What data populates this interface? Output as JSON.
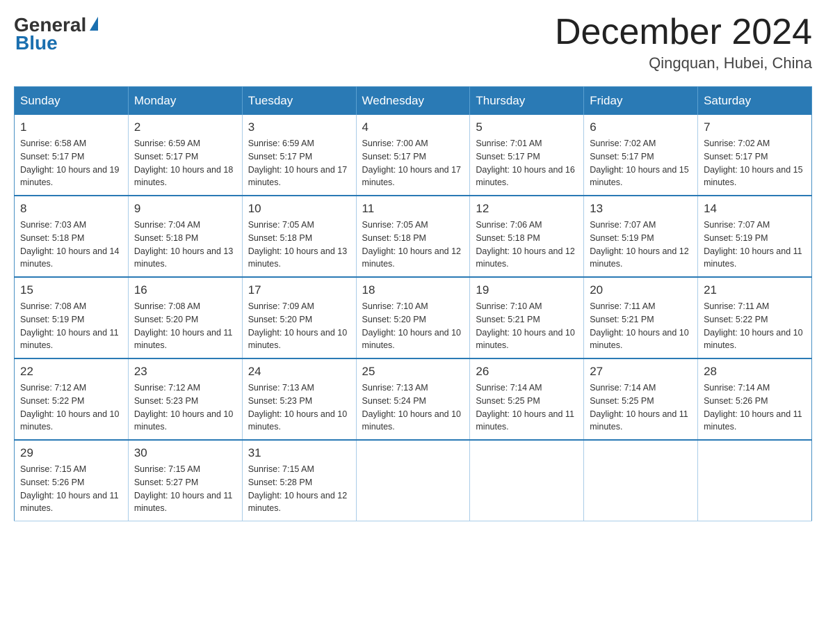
{
  "logo": {
    "general": "General",
    "blue": "Blue"
  },
  "header": {
    "month_title": "December 2024",
    "location": "Qingquan, Hubei, China"
  },
  "days_of_week": [
    "Sunday",
    "Monday",
    "Tuesday",
    "Wednesday",
    "Thursday",
    "Friday",
    "Saturday"
  ],
  "weeks": [
    [
      {
        "day": "1",
        "sunrise": "Sunrise: 6:58 AM",
        "sunset": "Sunset: 5:17 PM",
        "daylight": "Daylight: 10 hours and 19 minutes."
      },
      {
        "day": "2",
        "sunrise": "Sunrise: 6:59 AM",
        "sunset": "Sunset: 5:17 PM",
        "daylight": "Daylight: 10 hours and 18 minutes."
      },
      {
        "day": "3",
        "sunrise": "Sunrise: 6:59 AM",
        "sunset": "Sunset: 5:17 PM",
        "daylight": "Daylight: 10 hours and 17 minutes."
      },
      {
        "day": "4",
        "sunrise": "Sunrise: 7:00 AM",
        "sunset": "Sunset: 5:17 PM",
        "daylight": "Daylight: 10 hours and 17 minutes."
      },
      {
        "day": "5",
        "sunrise": "Sunrise: 7:01 AM",
        "sunset": "Sunset: 5:17 PM",
        "daylight": "Daylight: 10 hours and 16 minutes."
      },
      {
        "day": "6",
        "sunrise": "Sunrise: 7:02 AM",
        "sunset": "Sunset: 5:17 PM",
        "daylight": "Daylight: 10 hours and 15 minutes."
      },
      {
        "day": "7",
        "sunrise": "Sunrise: 7:02 AM",
        "sunset": "Sunset: 5:17 PM",
        "daylight": "Daylight: 10 hours and 15 minutes."
      }
    ],
    [
      {
        "day": "8",
        "sunrise": "Sunrise: 7:03 AM",
        "sunset": "Sunset: 5:18 PM",
        "daylight": "Daylight: 10 hours and 14 minutes."
      },
      {
        "day": "9",
        "sunrise": "Sunrise: 7:04 AM",
        "sunset": "Sunset: 5:18 PM",
        "daylight": "Daylight: 10 hours and 13 minutes."
      },
      {
        "day": "10",
        "sunrise": "Sunrise: 7:05 AM",
        "sunset": "Sunset: 5:18 PM",
        "daylight": "Daylight: 10 hours and 13 minutes."
      },
      {
        "day": "11",
        "sunrise": "Sunrise: 7:05 AM",
        "sunset": "Sunset: 5:18 PM",
        "daylight": "Daylight: 10 hours and 12 minutes."
      },
      {
        "day": "12",
        "sunrise": "Sunrise: 7:06 AM",
        "sunset": "Sunset: 5:18 PM",
        "daylight": "Daylight: 10 hours and 12 minutes."
      },
      {
        "day": "13",
        "sunrise": "Sunrise: 7:07 AM",
        "sunset": "Sunset: 5:19 PM",
        "daylight": "Daylight: 10 hours and 12 minutes."
      },
      {
        "day": "14",
        "sunrise": "Sunrise: 7:07 AM",
        "sunset": "Sunset: 5:19 PM",
        "daylight": "Daylight: 10 hours and 11 minutes."
      }
    ],
    [
      {
        "day": "15",
        "sunrise": "Sunrise: 7:08 AM",
        "sunset": "Sunset: 5:19 PM",
        "daylight": "Daylight: 10 hours and 11 minutes."
      },
      {
        "day": "16",
        "sunrise": "Sunrise: 7:08 AM",
        "sunset": "Sunset: 5:20 PM",
        "daylight": "Daylight: 10 hours and 11 minutes."
      },
      {
        "day": "17",
        "sunrise": "Sunrise: 7:09 AM",
        "sunset": "Sunset: 5:20 PM",
        "daylight": "Daylight: 10 hours and 10 minutes."
      },
      {
        "day": "18",
        "sunrise": "Sunrise: 7:10 AM",
        "sunset": "Sunset: 5:20 PM",
        "daylight": "Daylight: 10 hours and 10 minutes."
      },
      {
        "day": "19",
        "sunrise": "Sunrise: 7:10 AM",
        "sunset": "Sunset: 5:21 PM",
        "daylight": "Daylight: 10 hours and 10 minutes."
      },
      {
        "day": "20",
        "sunrise": "Sunrise: 7:11 AM",
        "sunset": "Sunset: 5:21 PM",
        "daylight": "Daylight: 10 hours and 10 minutes."
      },
      {
        "day": "21",
        "sunrise": "Sunrise: 7:11 AM",
        "sunset": "Sunset: 5:22 PM",
        "daylight": "Daylight: 10 hours and 10 minutes."
      }
    ],
    [
      {
        "day": "22",
        "sunrise": "Sunrise: 7:12 AM",
        "sunset": "Sunset: 5:22 PM",
        "daylight": "Daylight: 10 hours and 10 minutes."
      },
      {
        "day": "23",
        "sunrise": "Sunrise: 7:12 AM",
        "sunset": "Sunset: 5:23 PM",
        "daylight": "Daylight: 10 hours and 10 minutes."
      },
      {
        "day": "24",
        "sunrise": "Sunrise: 7:13 AM",
        "sunset": "Sunset: 5:23 PM",
        "daylight": "Daylight: 10 hours and 10 minutes."
      },
      {
        "day": "25",
        "sunrise": "Sunrise: 7:13 AM",
        "sunset": "Sunset: 5:24 PM",
        "daylight": "Daylight: 10 hours and 10 minutes."
      },
      {
        "day": "26",
        "sunrise": "Sunrise: 7:14 AM",
        "sunset": "Sunset: 5:25 PM",
        "daylight": "Daylight: 10 hours and 11 minutes."
      },
      {
        "day": "27",
        "sunrise": "Sunrise: 7:14 AM",
        "sunset": "Sunset: 5:25 PM",
        "daylight": "Daylight: 10 hours and 11 minutes."
      },
      {
        "day": "28",
        "sunrise": "Sunrise: 7:14 AM",
        "sunset": "Sunset: 5:26 PM",
        "daylight": "Daylight: 10 hours and 11 minutes."
      }
    ],
    [
      {
        "day": "29",
        "sunrise": "Sunrise: 7:15 AM",
        "sunset": "Sunset: 5:26 PM",
        "daylight": "Daylight: 10 hours and 11 minutes."
      },
      {
        "day": "30",
        "sunrise": "Sunrise: 7:15 AM",
        "sunset": "Sunset: 5:27 PM",
        "daylight": "Daylight: 10 hours and 11 minutes."
      },
      {
        "day": "31",
        "sunrise": "Sunrise: 7:15 AM",
        "sunset": "Sunset: 5:28 PM",
        "daylight": "Daylight: 10 hours and 12 minutes."
      },
      null,
      null,
      null,
      null
    ]
  ]
}
